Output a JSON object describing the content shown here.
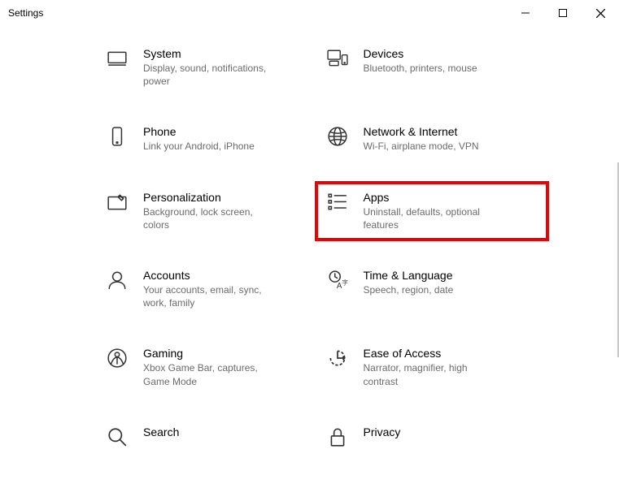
{
  "window": {
    "title": "Settings"
  },
  "tiles": {
    "system": {
      "title": "System",
      "desc": "Display, sound, notifications, power"
    },
    "devices": {
      "title": "Devices",
      "desc": "Bluetooth, printers, mouse"
    },
    "phone": {
      "title": "Phone",
      "desc": "Link your Android, iPhone"
    },
    "network": {
      "title": "Network & Internet",
      "desc": "Wi-Fi, airplane mode, VPN"
    },
    "personalization": {
      "title": "Personalization",
      "desc": "Background, lock screen, colors"
    },
    "apps": {
      "title": "Apps",
      "desc": "Uninstall, defaults, optional features"
    },
    "accounts": {
      "title": "Accounts",
      "desc": "Your accounts, email, sync, work, family"
    },
    "time": {
      "title": "Time & Language",
      "desc": "Speech, region, date"
    },
    "gaming": {
      "title": "Gaming",
      "desc": "Xbox Game Bar, captures, Game Mode"
    },
    "ease": {
      "title": "Ease of Access",
      "desc": "Narrator, magnifier, high contrast"
    },
    "search": {
      "title": "Search",
      "desc": ""
    },
    "privacy": {
      "title": "Privacy",
      "desc": ""
    }
  }
}
